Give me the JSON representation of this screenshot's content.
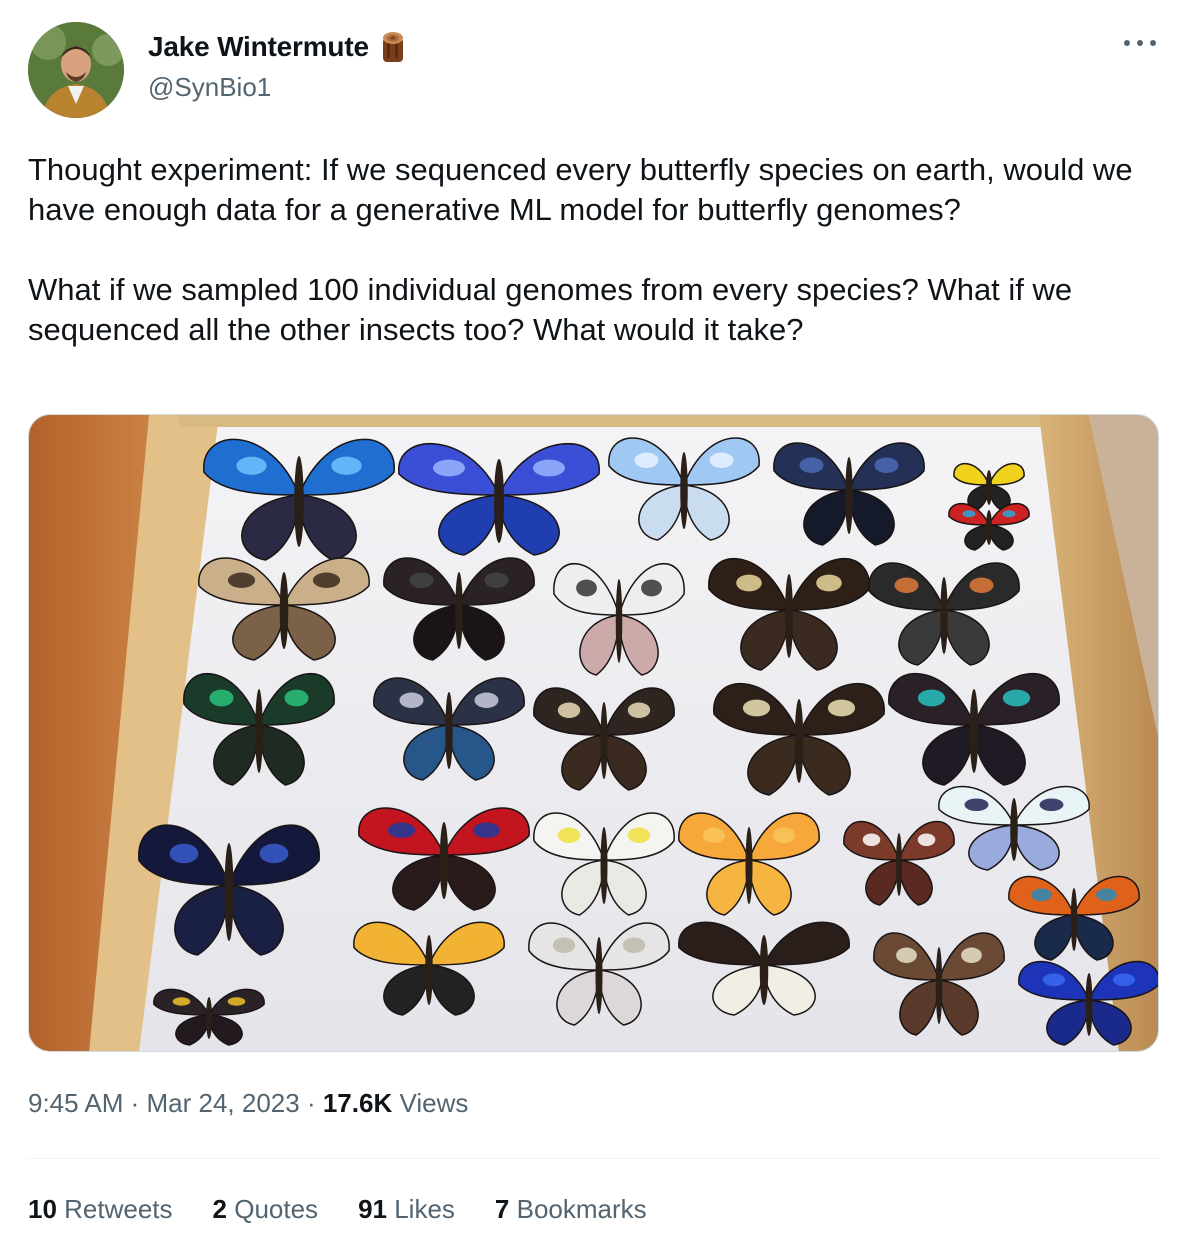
{
  "user": {
    "display_name": "Jake Wintermute",
    "handle": "@SynBio1",
    "badge_icon": "wood-log-icon"
  },
  "tweet": {
    "paragraph_1": "Thought experiment: If we sequenced every butterfly species on earth, would we have enough data for a generative ML model for butterfly genomes?",
    "paragraph_2": "What if we sampled 100 individual genomes from every species? What if we sequenced all the other insects too? What would it take?",
    "media_icon": "butterfly-specimen-photo"
  },
  "meta": {
    "time": "9:45 AM",
    "separator": " · ",
    "date": "Mar 24, 2023",
    "views_count": "17.6K",
    "views_label": " Views"
  },
  "stats": {
    "retweets_count": "10",
    "retweets_label": " Retweets",
    "quotes_count": "2",
    "quotes_label": " Quotes",
    "likes_count": "91",
    "likes_label": " Likes",
    "bookmarks_count": "7",
    "bookmarks_label": " Bookmarks"
  },
  "colors": {
    "text_primary": "#0f1419",
    "text_secondary": "#536471",
    "divider": "#eff3f4"
  }
}
